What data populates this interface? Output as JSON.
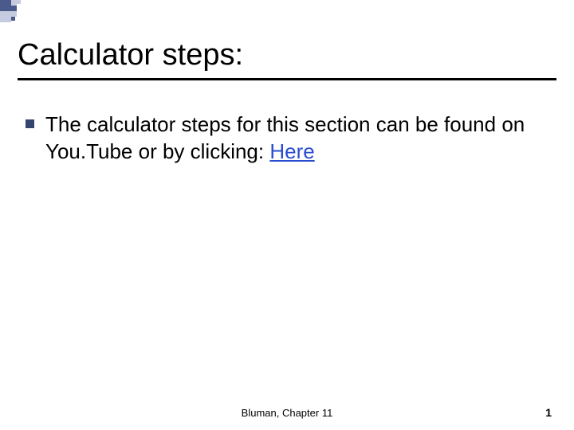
{
  "slide": {
    "title": "Calculator steps:",
    "bullet_text_part1": "The calculator steps for this section can be found on You.Tube or by clicking:  ",
    "link_text": "Here"
  },
  "footer": {
    "text": "Bluman, Chapter 11",
    "page_number": "1"
  },
  "colors": {
    "accent_dark": "#4a5a8a",
    "accent_light": "#c5cce0",
    "link": "#2a4cd0"
  }
}
